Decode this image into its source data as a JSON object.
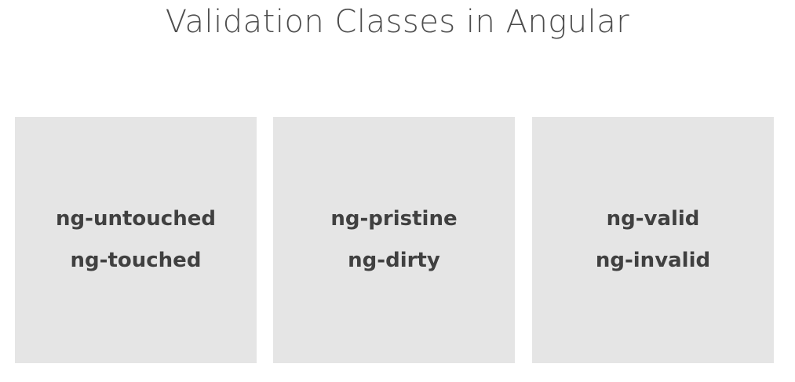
{
  "slide": {
    "title": "Validation Classes in Angular"
  },
  "cards": [
    {
      "line1": "ng-untouched",
      "line2": "ng-touched"
    },
    {
      "line1": "ng-pristine",
      "line2": "ng-dirty"
    },
    {
      "line1": "ng-valid",
      "line2": "ng-invalid"
    }
  ],
  "colors": {
    "title_text": "#4d4d4d",
    "card_background": "#e5e5e5",
    "card_text": "#404040"
  }
}
